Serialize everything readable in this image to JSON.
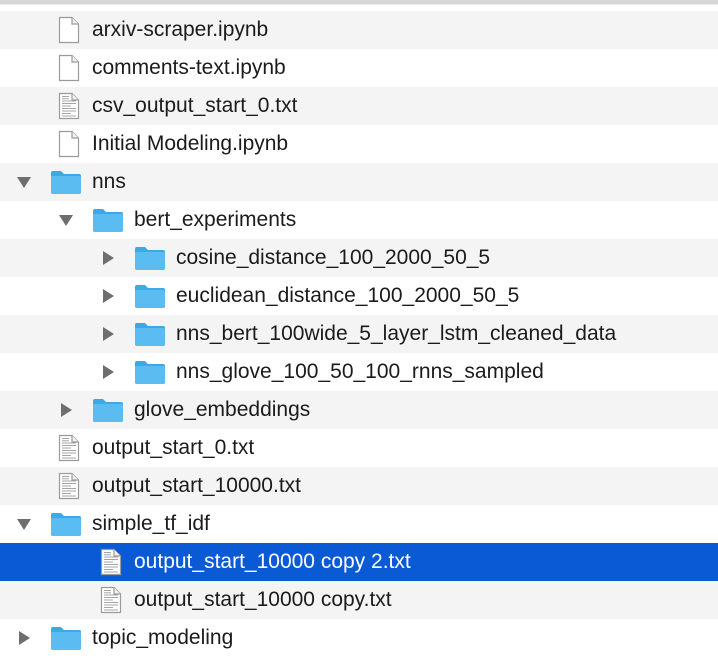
{
  "colors": {
    "row_alt": "#f4f4f5",
    "selection": "#0a5ad6",
    "folder": "#5bbcf1",
    "folder_tab": "#3da8e6",
    "text": "#1b1b1b",
    "selected_text": "#ffffff"
  },
  "tree": {
    "items": [
      {
        "label": "arxiv-scraper.ipynb",
        "icon": "document-icon",
        "level": 1,
        "disclosure": "none",
        "alt": true
      },
      {
        "label": "comments-text.ipynb",
        "icon": "document-icon",
        "level": 1,
        "disclosure": "none",
        "alt": false
      },
      {
        "label": "csv_output_start_0.txt",
        "icon": "text-document-icon",
        "level": 1,
        "disclosure": "none",
        "alt": true
      },
      {
        "label": "Initial Modeling.ipynb",
        "icon": "document-icon",
        "level": 1,
        "disclosure": "none",
        "alt": false
      },
      {
        "label": "nns",
        "icon": "folder-icon",
        "level": 1,
        "disclosure": "expanded",
        "alt": true
      },
      {
        "label": "bert_experiments",
        "icon": "folder-icon",
        "level": 2,
        "disclosure": "expanded",
        "alt": false
      },
      {
        "label": "cosine_distance_100_2000_50_5",
        "icon": "folder-icon",
        "level": 3,
        "disclosure": "collapsed",
        "alt": true
      },
      {
        "label": "euclidean_distance_100_2000_50_5",
        "icon": "folder-icon",
        "level": 3,
        "disclosure": "collapsed",
        "alt": false
      },
      {
        "label": "nns_bert_100wide_5_layer_lstm_cleaned_data",
        "icon": "folder-icon",
        "level": 3,
        "disclosure": "collapsed",
        "alt": true
      },
      {
        "label": "nns_glove_100_50_100_rnns_sampled",
        "icon": "folder-icon",
        "level": 3,
        "disclosure": "collapsed",
        "alt": false
      },
      {
        "label": "glove_embeddings",
        "icon": "folder-icon",
        "level": 2,
        "disclosure": "collapsed",
        "alt": true
      },
      {
        "label": "output_start_0.txt",
        "icon": "text-document-icon",
        "level": 1,
        "disclosure": "none",
        "alt": false
      },
      {
        "label": "output_start_10000.txt",
        "icon": "text-document-icon",
        "level": 1,
        "disclosure": "none",
        "alt": true
      },
      {
        "label": "simple_tf_idf",
        "icon": "folder-icon",
        "level": 1,
        "disclosure": "expanded",
        "alt": false
      },
      {
        "label": "output_start_10000 copy 2.txt",
        "icon": "text-document-icon",
        "level": 2,
        "disclosure": "none",
        "alt": false,
        "selected": true
      },
      {
        "label": "output_start_10000 copy.txt",
        "icon": "text-document-icon",
        "level": 2,
        "disclosure": "none",
        "alt": true
      },
      {
        "label": "topic_modeling",
        "icon": "folder-icon",
        "level": 1,
        "disclosure": "collapsed",
        "alt": false
      }
    ]
  }
}
